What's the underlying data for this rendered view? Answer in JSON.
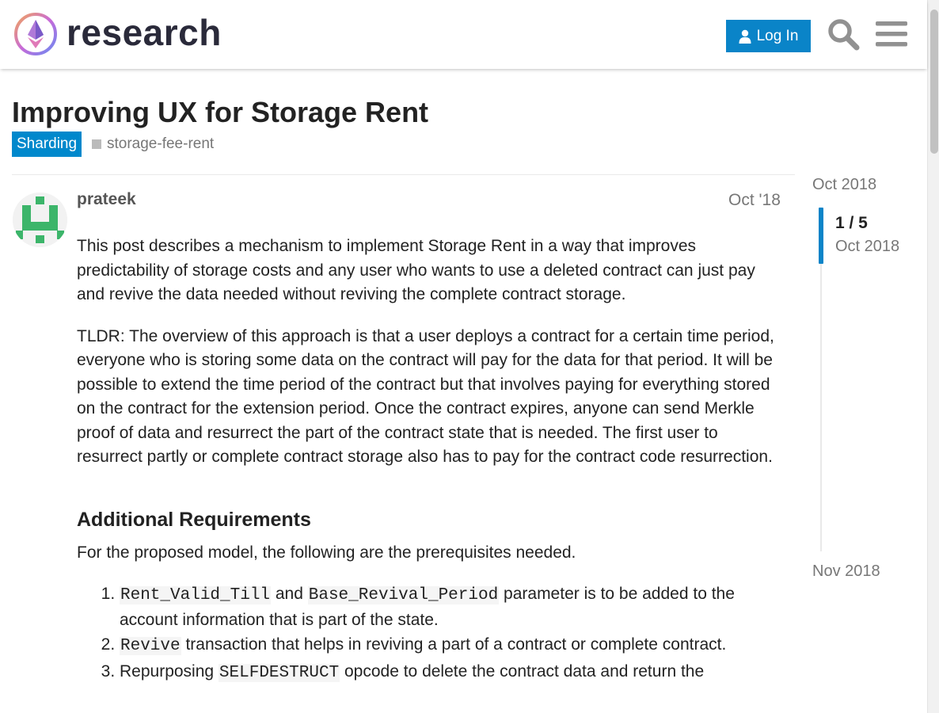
{
  "header": {
    "logo_text": "research",
    "login_label": "Log In"
  },
  "topic": {
    "title": "Improving UX for Storage Rent",
    "category": "Sharding",
    "category_color": "#0088cc",
    "tag": "storage-fee-rent"
  },
  "post": {
    "author": "prateek",
    "date": "Oct '18",
    "paragraphs": [
      "This post describes a mechanism to implement Storage Rent in a way that improves predictability of storage costs and any user who wants to use a deleted contract can just pay and revive the data needed without reviving the complete contract storage.",
      "TLDR: The overview of this approach is that a user deploys a contract for a certain time period, everyone who is storing some data on the contract will pay for the data for that period. It will be possible to extend the time period of the contract but that involves paying for everything stored on the contract for the extension period. Once the contract expires, anyone can send Merkle proof of data and resurrect the part of the contract state that is needed. The first user to resurrect partly or complete contract storage also has to pay for the contract code resurrection."
    ],
    "section_heading": "Additional Requirements",
    "section_intro": "For the proposed model, the following are the prerequisites needed.",
    "list": [
      {
        "code1": "Rent_Valid_Till",
        "mid": " and ",
        "code2": "Base_Revival_Period",
        "text": " parameter is to be added to the account information that is part of the state."
      },
      {
        "code1": "Revive",
        "text": " transaction that helps in reviving a part of a contract or complete contract."
      },
      {
        "pre": "Repurposing ",
        "code1": "SELFDESTRUCT",
        "text": " opcode to delete the contract data and return the"
      }
    ]
  },
  "timeline": {
    "start_date": "Oct 2018",
    "position": "1 / 5",
    "current_date": "Oct 2018",
    "end_date": "Nov 2018"
  },
  "colors": {
    "accent": "#0a84c8",
    "avatar": "#3cb56a"
  },
  "icons": [
    "user-icon",
    "search-icon",
    "hamburger-menu-icon"
  ]
}
